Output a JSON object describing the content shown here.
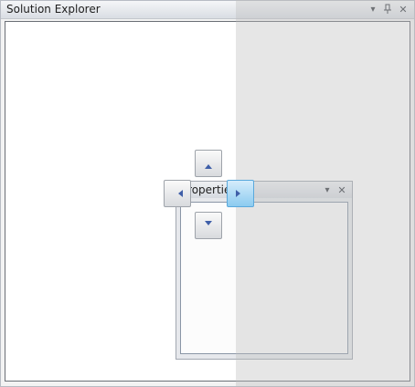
{
  "solution_explorer": {
    "title": "Solution Explorer",
    "buttons": [
      {
        "icon": "dropdown-arrow-icon",
        "glyph": "▾"
      },
      {
        "icon": "pin-icon",
        "glyph": "⊥"
      },
      {
        "icon": "close-icon",
        "glyph": "✕"
      }
    ]
  },
  "properties_window": {
    "title": "Properties",
    "buttons": [
      {
        "icon": "dropdown-arrow-icon",
        "glyph": "▾"
      },
      {
        "icon": "close-icon",
        "glyph": "✕"
      }
    ]
  },
  "dock_guides": {
    "directions": [
      "top",
      "left",
      "right",
      "bottom"
    ],
    "highlighted": "right"
  }
}
